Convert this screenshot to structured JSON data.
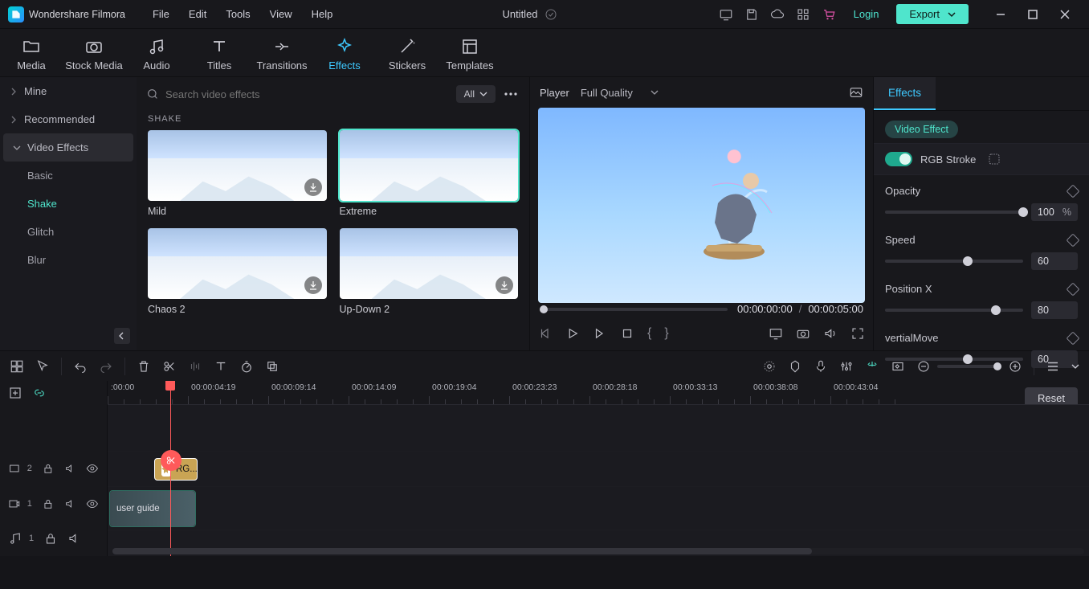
{
  "app": {
    "brand": "Wondershare Filmora"
  },
  "menus": [
    "File",
    "Edit",
    "Tools",
    "View",
    "Help"
  ],
  "title": {
    "name": "Untitled"
  },
  "export": "Export",
  "login": "Login",
  "ribbon": [
    {
      "key": "media",
      "label": "Media"
    },
    {
      "key": "stock",
      "label": "Stock Media"
    },
    {
      "key": "audio",
      "label": "Audio"
    },
    {
      "key": "titles",
      "label": "Titles"
    },
    {
      "key": "transitions",
      "label": "Transitions"
    },
    {
      "key": "effects",
      "label": "Effects",
      "active": true
    },
    {
      "key": "stickers",
      "label": "Stickers"
    },
    {
      "key": "templates",
      "label": "Templates"
    }
  ],
  "side": {
    "mine": "Mine",
    "recommended": "Recommended",
    "videoEffects": "Video Effects",
    "subs": [
      "Basic",
      "Shake",
      "Glitch",
      "Blur"
    ],
    "activeSub": "Shake"
  },
  "search": {
    "placeholder": "Search video effects",
    "all": "All"
  },
  "section": "SHAKE",
  "cards": [
    {
      "label": "Mild"
    },
    {
      "label": "Extreme",
      "selected": true
    },
    {
      "label": "Chaos 2",
      "dl": true
    },
    {
      "label": "Up-Down 2",
      "dl": true
    }
  ],
  "player": {
    "title": "Player",
    "quality": "Full Quality",
    "cur": "00:00:00:00",
    "dur": "00:00:05:00"
  },
  "props": {
    "tab": "Effects",
    "subtab": "Video Effect",
    "effectName": "RGB Stroke",
    "params": [
      {
        "name": "Opacity",
        "value": "100",
        "unit": "%",
        "pct": 100
      },
      {
        "name": "Speed",
        "value": "60",
        "unit": "",
        "pct": 60
      },
      {
        "name": "Position X",
        "value": "80",
        "unit": "",
        "pct": 80
      },
      {
        "name": "vertialMove",
        "value": "60",
        "unit": "",
        "pct": 60
      }
    ],
    "reset": "Reset"
  },
  "ruler": [
    ":00:00",
    "00:00:04:19",
    "00:00:09:14",
    "00:00:14:09",
    "00:00:19:04",
    "00:00:23:23",
    "00:00:28:18",
    "00:00:33:13",
    "00:00:38:08",
    "00:00:43:04"
  ],
  "tracks": {
    "t2": {
      "icon": "fx",
      "num": "2"
    },
    "t1": {
      "icon": "vid",
      "num": "1"
    },
    "a1": {
      "icon": "aud",
      "num": "1"
    }
  },
  "clips": {
    "rg": "RG...",
    "vid": "user guide"
  }
}
